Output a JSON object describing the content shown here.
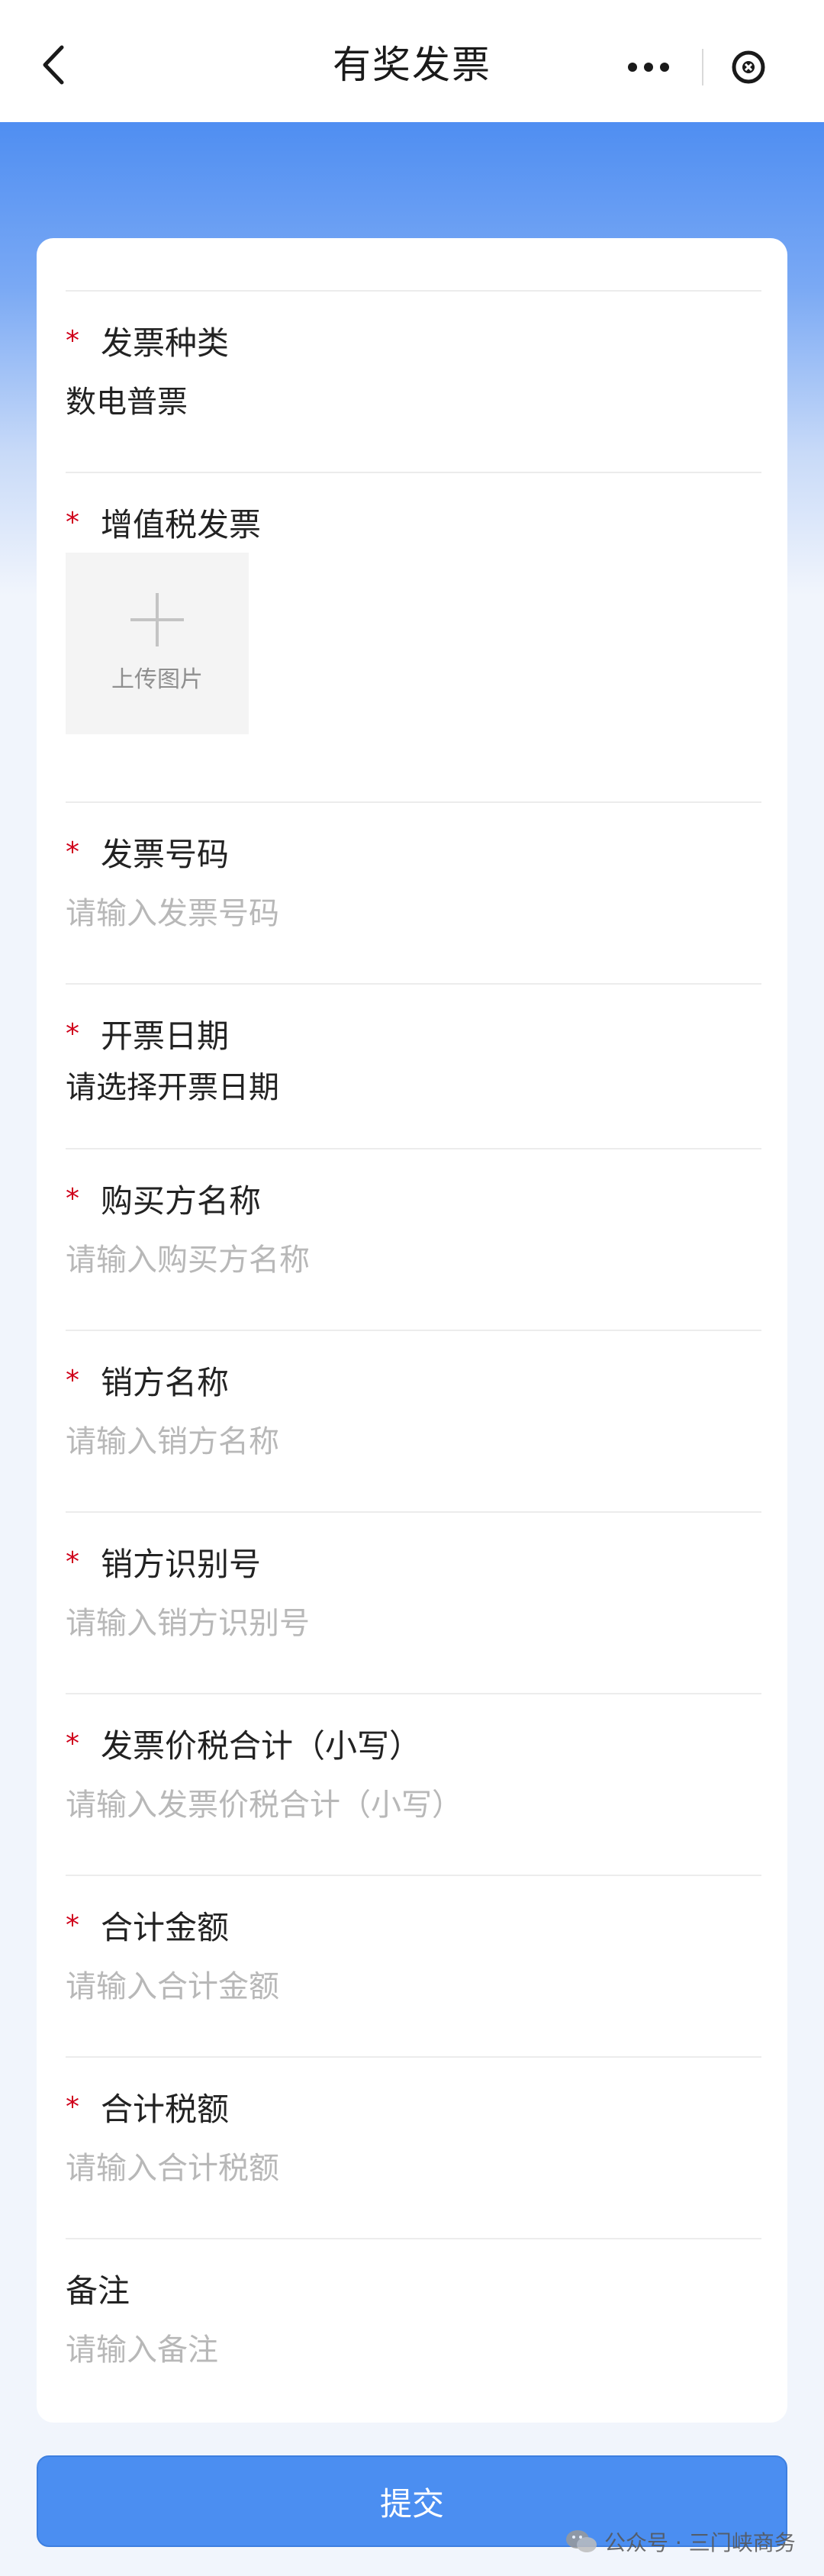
{
  "nav": {
    "title": "有奖发票",
    "more_label": "•••"
  },
  "colors": {
    "accent": "#4b8ef1",
    "required": "#d0021b",
    "placeholder": "#b8b8b8"
  },
  "form": {
    "invoice_type": {
      "label": "发票种类",
      "value": "数电普票",
      "required": true
    },
    "vat_invoice": {
      "label": "增值税发票",
      "upload_label": "上传图片",
      "required": true
    },
    "invoice_number": {
      "label": "发票号码",
      "placeholder": "请输入发票号码",
      "required": true
    },
    "invoice_date": {
      "label": "开票日期",
      "value": "请选择开票日期",
      "required": true
    },
    "buyer_name": {
      "label": "购买方名称",
      "placeholder": "请输入购买方名称",
      "required": true
    },
    "seller_name": {
      "label": "销方名称",
      "placeholder": "请输入销方名称",
      "required": true
    },
    "seller_tax_id": {
      "label": "销方识别号",
      "placeholder": "请输入销方识别号",
      "required": true
    },
    "total_with_tax": {
      "label": "发票价税合计（小写）",
      "placeholder": "请输入发票价税合计（小写）",
      "required": true
    },
    "total_amount": {
      "label": "合计金额",
      "placeholder": "请输入合计金额",
      "required": true
    },
    "total_tax": {
      "label": "合计税额",
      "placeholder": "请输入合计税额",
      "required": true
    },
    "remarks": {
      "label": "备注",
      "placeholder": "请输入备注",
      "required": false
    }
  },
  "required_mark": "*",
  "submit_label": "提交",
  "watermark": "公众号 · 三门峡商务"
}
